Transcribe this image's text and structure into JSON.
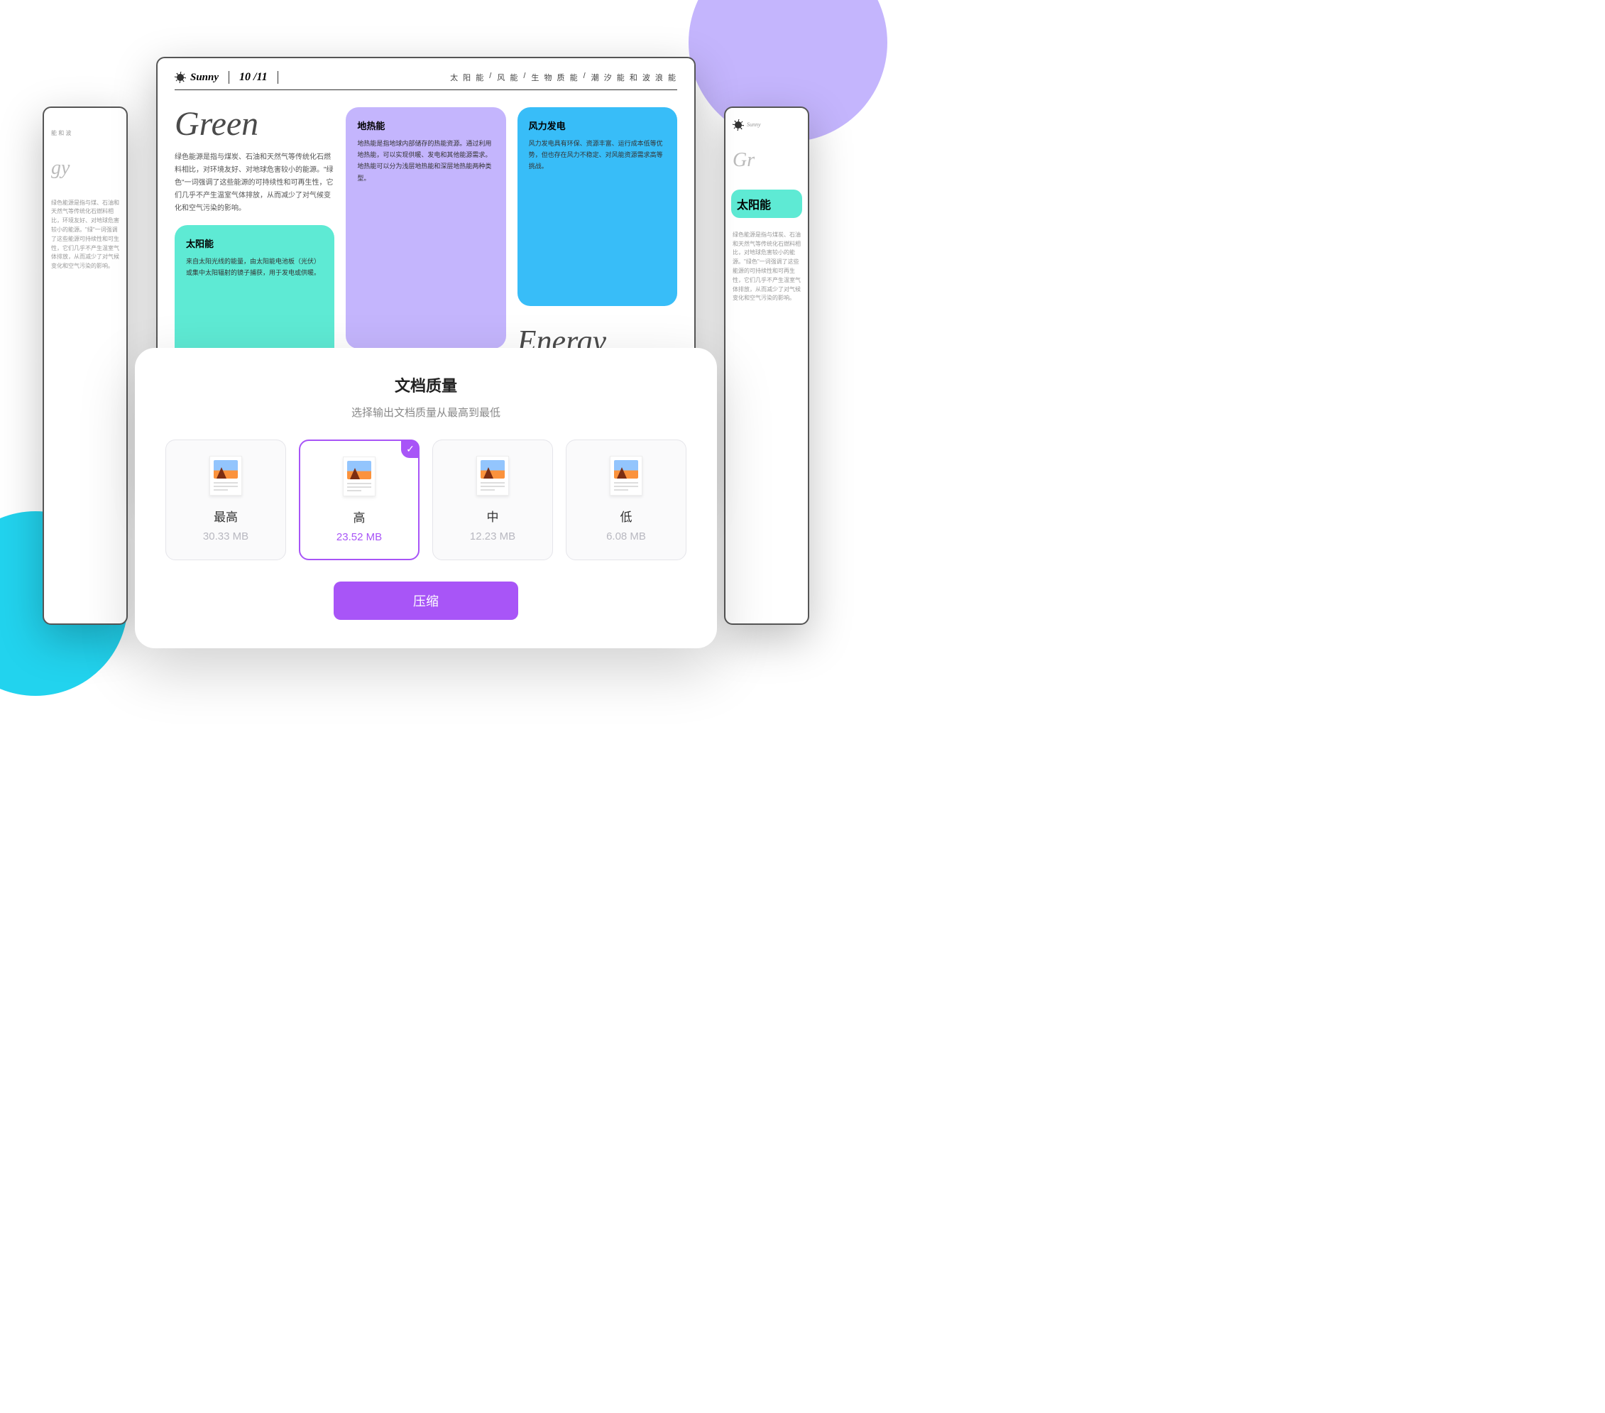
{
  "doc": {
    "brand": "Sunny",
    "date": "10 /11",
    "nav": [
      "太 阳 能",
      "/",
      "风 能",
      "/",
      "生 物 质 能",
      "/",
      "潮 汐 能 和 波 浪 能"
    ],
    "title": "Green",
    "intro": "绿色能源是指与煤炭、石油和天然气等传统化石燃料相比，对环境友好、对地球危害较小的能源。\"绿色\"一词强调了这些能源的可持续性和可再生性，它们几乎不产生温室气体排放，从而减少了对气候变化和空气污染的影响。",
    "solar": {
      "title": "太阳能",
      "body": "来自太阳光线的能量，由太阳能电池板（光伏）或集中太阳辐射的镜子捕获，用于发电或供暖。"
    },
    "geo": {
      "title": "地热能",
      "body": "地热能是指地球内部储存的热能资源。通过利用地热能，可以实现供暖、发电和其他能源需求。地热能可以分为浅层地热能和深层地热能两种类型。"
    },
    "wind": {
      "title": "风力发电",
      "body": "风力发电具有环保、资源丰富、运行成本低等优势，但也存在风力不稳定、对风能资源需求高等挑战。"
    },
    "energy_title": "Energy"
  },
  "side": {
    "brand": "Sunny",
    "title_left": "gy",
    "title_right": "Gr",
    "solar_title": "太阳能",
    "nav_frag": "能 和 波",
    "body_left": "绿色能源是指与煤、石油和天然气等传统化石燃料相比，环境友好、对地球危害较小的能源。\"绿\"一词强调了这些能源可持续性和可生性，它们几乎不产生温室气体排放，从而减少了对气候变化和空气污染的影响。",
    "body_right": "绿色能源是指与煤炭、石油和天然气等传统化石燃料相比，对地球危害较小的能源。\"绿色\"一词强调了这些能源的可持续性和可再生性，它们几乎不产生温室气体排放，从而减少了对气候变化和空气污染的影响。"
  },
  "modal": {
    "title": "文档质量",
    "subtitle": "选择输出文档质量从最高到最低",
    "options": [
      {
        "label": "最高",
        "size": "30.33 MB"
      },
      {
        "label": "高",
        "size": "23.52 MB"
      },
      {
        "label": "中",
        "size": "12.23 MB"
      },
      {
        "label": "低",
        "size": "6.08 MB"
      }
    ],
    "selected": 1,
    "button": "压缩"
  }
}
